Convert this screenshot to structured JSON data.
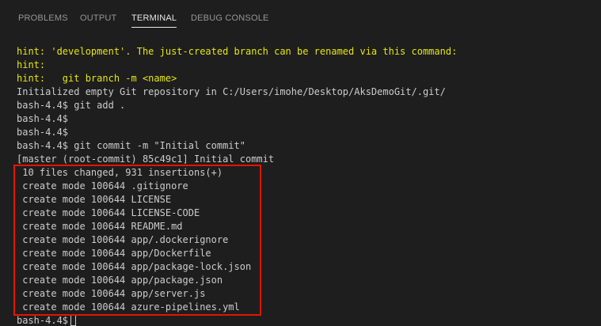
{
  "panel": {
    "tabs": [
      {
        "label": "PROBLEMS"
      },
      {
        "label": "OUTPUT"
      },
      {
        "label": "TERMINAL"
      },
      {
        "label": "DEBUG CONSOLE"
      }
    ],
    "active_tab": "TERMINAL"
  },
  "terminal": {
    "colors": {
      "background": "#1e1e1e",
      "text": "#cccccc",
      "hint": "#e5e510",
      "highlight_border": "#e51400"
    },
    "lines": [
      "hint: 'development'. The just-created branch can be renamed via this command:",
      "hint:",
      "hint:   git branch -m <name>",
      "Initialized empty Git repository in C:/Users/imohe/Desktop/AksDemoGit/.git/",
      "bash-4.4$ git add .",
      "bash-4.4$",
      "bash-4.4$",
      "bash-4.4$ git commit -m \"Initial commit\"",
      "[master (root-commit) 85c49c1] Initial commit",
      " 10 files changed, 931 insertions(+)",
      " create mode 100644 .gitignore",
      " create mode 100644 LICENSE",
      " create mode 100644 LICENSE-CODE",
      " create mode 100644 README.md",
      " create mode 100644 app/.dockerignore",
      " create mode 100644 app/Dockerfile",
      " create mode 100644 app/package-lock.json",
      " create mode 100644 app/package.json",
      " create mode 100644 app/server.js",
      " create mode 100644 azure-pipelines.yml"
    ],
    "prompt": "bash-4.4$"
  }
}
